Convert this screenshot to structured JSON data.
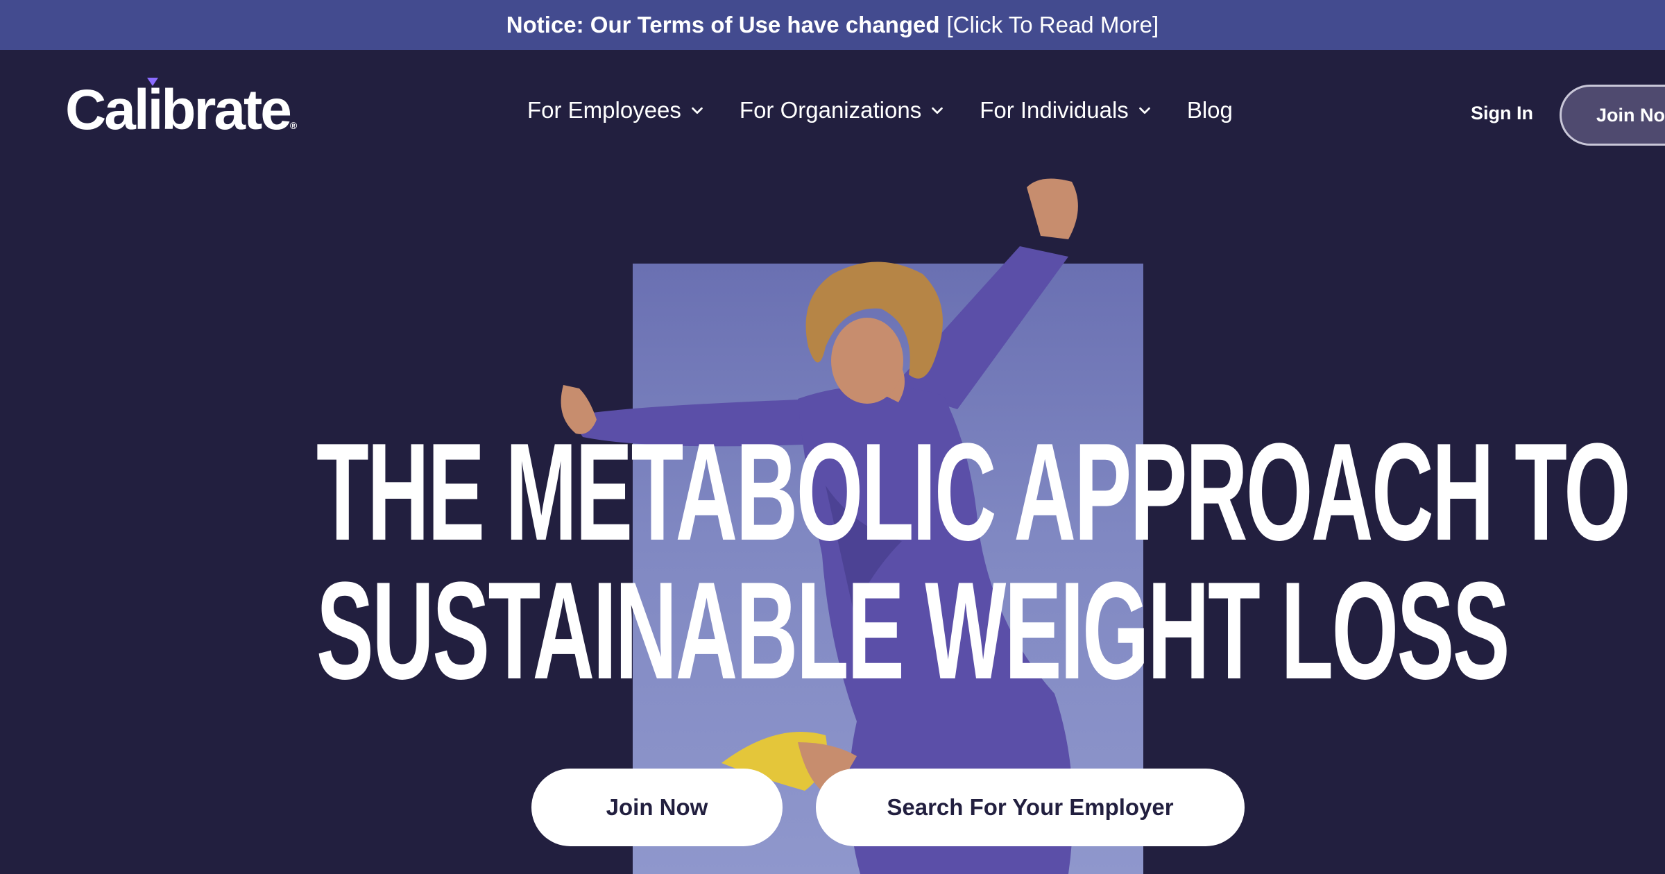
{
  "notice": {
    "strong_text": "Notice: Our Terms of Use have changed",
    "link_text": "[Click To Read More]"
  },
  "header": {
    "logo_text": "Calibrate",
    "logo_mark": "®",
    "nav": [
      {
        "label": "For Employees",
        "icon": "chevron-down-icon"
      },
      {
        "label": "For Organizations",
        "icon": "chevron-down-icon"
      },
      {
        "label": "For Individuals",
        "icon": "chevron-down-icon"
      },
      {
        "label": "Blog"
      }
    ],
    "sign_in": "Sign In",
    "join_now": "Join Now"
  },
  "hero": {
    "headline_line1": "THE METABOLIC APPROACH TO",
    "headline_line2": "SUSTAINABLE WEIGHT LOSS",
    "cta_primary": "Join Now",
    "cta_secondary": "Search For Your Employer"
  },
  "colors": {
    "background": "#221f3f",
    "notice_bar": "#434b8f",
    "photo_bg": "#7a82bd",
    "dress": "#5b4fa8",
    "shoe": "#e4c63a",
    "accent": "#8b6cff"
  }
}
